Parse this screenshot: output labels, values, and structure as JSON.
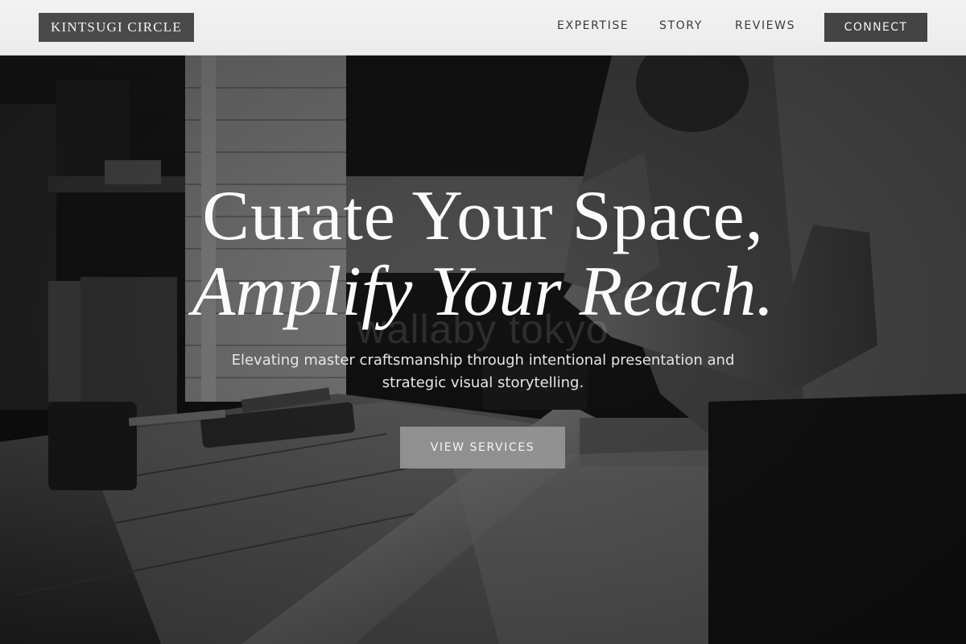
{
  "header": {
    "logo": "KINTSUGI CIRCLE",
    "nav": [
      {
        "label": "EXPERTISE"
      },
      {
        "label": "STORY"
      },
      {
        "label": "REVIEWS"
      }
    ],
    "cta_label": "CONNECT"
  },
  "hero": {
    "headline_line1": "Curate Your Space,",
    "headline_line2": "Amplify Your Reach.",
    "watermark": "wallaby tokyo",
    "subtitle": "Elevating master craftsmanship through intentional presentation and strategic visual storytelling.",
    "button_label": "VIEW SERVICES",
    "image": "black-and-white photo of a craftsman planing wood at a workbench"
  },
  "colors": {
    "header_bg": "#efefef",
    "logo_bg": "#4a4a4a",
    "cta_bg": "#444444",
    "button_bg": "#969696",
    "text_light": "#fafafa"
  }
}
